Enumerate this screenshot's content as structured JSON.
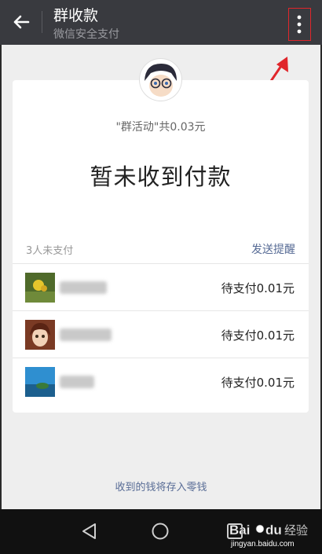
{
  "header": {
    "title": "群收款",
    "subtitle": "微信安全支付",
    "back_icon": "arrow-left-icon",
    "more_icon": "more-vertical-icon"
  },
  "card": {
    "summary": "\"群活动\"共0.03元",
    "status": "暂未收到付款",
    "unpaid_count": "3人未支付",
    "remind_label": "发送提醒",
    "members": [
      {
        "amount_text": "待支付0.01元"
      },
      {
        "amount_text": "待支付0.01元"
      },
      {
        "amount_text": "待支付0.01元"
      }
    ]
  },
  "footer_note": "收到的钱将存入零钱",
  "colors": {
    "topbar": "#393a3f",
    "link": "#576b95",
    "annotation": "#e0262b"
  }
}
